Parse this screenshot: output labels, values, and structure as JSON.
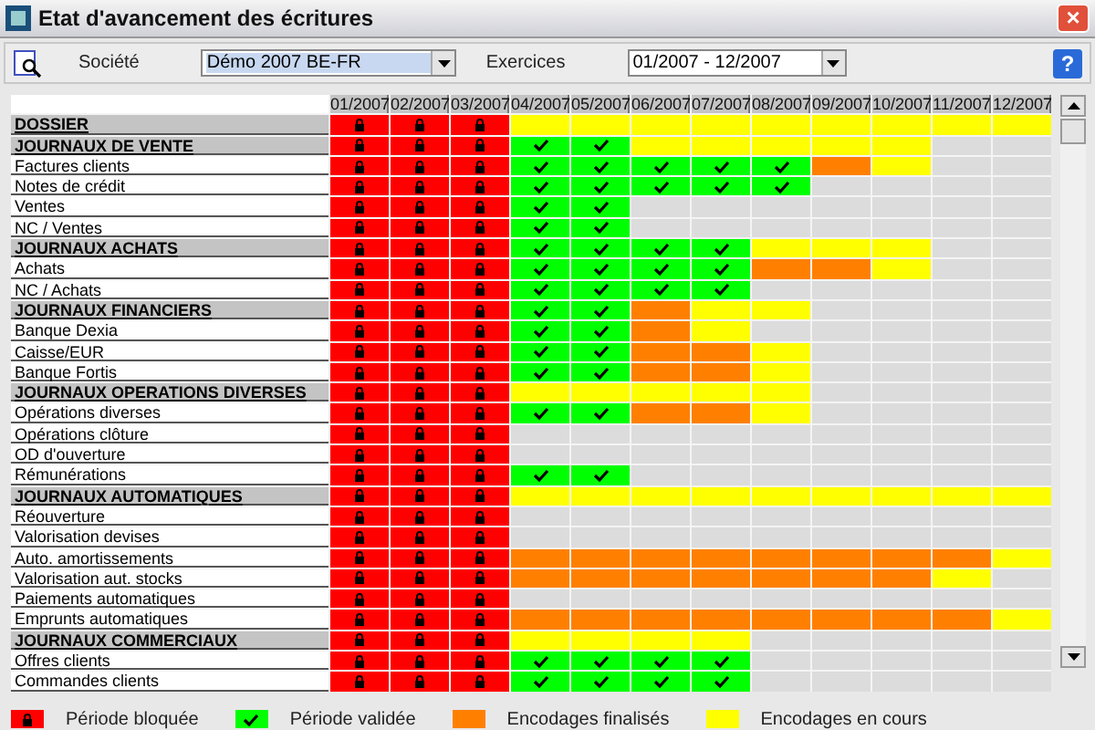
{
  "window": {
    "title": "Etat d'avancement des écritures",
    "close": "×"
  },
  "toolbar": {
    "company_label": "Société",
    "company_value": "Démo 2007 BE-FR",
    "period_label": "Exercices",
    "period_value": "01/2007 - 12/2007",
    "help": "?"
  },
  "columns": [
    "01/2007",
    "02/2007",
    "03/2007",
    "04/2007",
    "05/2007",
    "06/2007",
    "07/2007",
    "08/2007",
    "09/2007",
    "10/2007",
    "11/2007",
    "12/2007"
  ],
  "rows": [
    {
      "label": "DOSSIER",
      "kind": "group",
      "cells": [
        {
          "kind": "blocked"
        },
        {
          "kind": "blocked"
        },
        {
          "kind": "blocked"
        },
        {
          "kind": "pending"
        },
        {
          "kind": "pending"
        },
        {
          "kind": "pending"
        },
        {
          "kind": "pending"
        },
        {
          "kind": "pending"
        },
        {
          "kind": "pending"
        },
        {
          "kind": "pending"
        },
        {
          "kind": "pending"
        },
        {
          "kind": "pending"
        }
      ]
    },
    {
      "label": "JOURNAUX DE VENTE",
      "kind": "group",
      "cells": [
        {
          "kind": "blocked"
        },
        {
          "kind": "blocked"
        },
        {
          "kind": "blocked"
        },
        {
          "kind": "validated"
        },
        {
          "kind": "validated"
        },
        {
          "kind": "pending"
        },
        {
          "kind": "pending"
        },
        {
          "kind": "pending"
        },
        {
          "kind": "pending"
        },
        {
          "kind": "pending"
        },
        {
          "kind": "empty"
        },
        {
          "kind": "empty"
        }
      ]
    },
    {
      "label": "Factures clients",
      "kind": "journal",
      "cells": [
        {
          "kind": "blocked"
        },
        {
          "kind": "blocked"
        },
        {
          "kind": "blocked"
        },
        {
          "kind": "validated"
        },
        {
          "kind": "validated"
        },
        {
          "kind": "validated"
        },
        {
          "kind": "validated"
        },
        {
          "kind": "validated"
        },
        {
          "kind": "finalized"
        },
        {
          "kind": "pending"
        },
        {
          "kind": "empty"
        },
        {
          "kind": "empty"
        }
      ]
    },
    {
      "label": "Notes de crédit",
      "kind": "journal",
      "cells": [
        {
          "kind": "blocked"
        },
        {
          "kind": "blocked"
        },
        {
          "kind": "blocked"
        },
        {
          "kind": "validated"
        },
        {
          "kind": "validated"
        },
        {
          "kind": "validated"
        },
        {
          "kind": "validated"
        },
        {
          "kind": "validated"
        },
        {
          "kind": "empty"
        },
        {
          "kind": "empty"
        },
        {
          "kind": "empty"
        },
        {
          "kind": "empty"
        }
      ]
    },
    {
      "label": "Ventes",
      "kind": "journal",
      "cells": [
        {
          "kind": "blocked"
        },
        {
          "kind": "blocked"
        },
        {
          "kind": "blocked"
        },
        {
          "kind": "validated"
        },
        {
          "kind": "validated"
        },
        {
          "kind": "empty"
        },
        {
          "kind": "empty"
        },
        {
          "kind": "empty"
        },
        {
          "kind": "empty"
        },
        {
          "kind": "empty"
        },
        {
          "kind": "empty"
        },
        {
          "kind": "empty"
        }
      ]
    },
    {
      "label": "NC / Ventes",
      "kind": "journal",
      "cells": [
        {
          "kind": "blocked"
        },
        {
          "kind": "blocked"
        },
        {
          "kind": "blocked"
        },
        {
          "kind": "validated"
        },
        {
          "kind": "validated"
        },
        {
          "kind": "empty"
        },
        {
          "kind": "empty"
        },
        {
          "kind": "empty"
        },
        {
          "kind": "empty"
        },
        {
          "kind": "empty"
        },
        {
          "kind": "empty"
        },
        {
          "kind": "empty"
        }
      ]
    },
    {
      "label": "JOURNAUX ACHATS",
      "kind": "group",
      "cells": [
        {
          "kind": "blocked"
        },
        {
          "kind": "blocked"
        },
        {
          "kind": "blocked"
        },
        {
          "kind": "validated"
        },
        {
          "kind": "validated"
        },
        {
          "kind": "validated"
        },
        {
          "kind": "validated"
        },
        {
          "kind": "pending"
        },
        {
          "kind": "pending"
        },
        {
          "kind": "pending"
        },
        {
          "kind": "empty"
        },
        {
          "kind": "empty"
        }
      ]
    },
    {
      "label": "Achats",
      "kind": "journal",
      "cells": [
        {
          "kind": "blocked"
        },
        {
          "kind": "blocked"
        },
        {
          "kind": "blocked"
        },
        {
          "kind": "validated"
        },
        {
          "kind": "validated"
        },
        {
          "kind": "validated"
        },
        {
          "kind": "validated"
        },
        {
          "kind": "finalized"
        },
        {
          "kind": "finalized"
        },
        {
          "kind": "pending"
        },
        {
          "kind": "empty"
        },
        {
          "kind": "empty"
        }
      ]
    },
    {
      "label": "NC / Achats",
      "kind": "journal",
      "cells": [
        {
          "kind": "blocked"
        },
        {
          "kind": "blocked"
        },
        {
          "kind": "blocked"
        },
        {
          "kind": "validated"
        },
        {
          "kind": "validated"
        },
        {
          "kind": "validated"
        },
        {
          "kind": "validated"
        },
        {
          "kind": "empty"
        },
        {
          "kind": "empty"
        },
        {
          "kind": "empty"
        },
        {
          "kind": "empty"
        },
        {
          "kind": "empty"
        }
      ]
    },
    {
      "label": "JOURNAUX FINANCIERS",
      "kind": "group",
      "cells": [
        {
          "kind": "blocked"
        },
        {
          "kind": "blocked"
        },
        {
          "kind": "blocked"
        },
        {
          "kind": "validated"
        },
        {
          "kind": "validated"
        },
        {
          "kind": "finalized"
        },
        {
          "kind": "pending"
        },
        {
          "kind": "pending"
        },
        {
          "kind": "empty"
        },
        {
          "kind": "empty"
        },
        {
          "kind": "empty"
        },
        {
          "kind": "empty"
        }
      ]
    },
    {
      "label": "Banque Dexia",
      "kind": "journal",
      "cells": [
        {
          "kind": "blocked"
        },
        {
          "kind": "blocked"
        },
        {
          "kind": "blocked"
        },
        {
          "kind": "validated"
        },
        {
          "kind": "validated"
        },
        {
          "kind": "finalized"
        },
        {
          "kind": "pending"
        },
        {
          "kind": "empty"
        },
        {
          "kind": "empty"
        },
        {
          "kind": "empty"
        },
        {
          "kind": "empty"
        },
        {
          "kind": "empty"
        }
      ]
    },
    {
      "label": "Caisse/EUR",
      "kind": "journal",
      "cells": [
        {
          "kind": "blocked"
        },
        {
          "kind": "blocked"
        },
        {
          "kind": "blocked"
        },
        {
          "kind": "validated"
        },
        {
          "kind": "validated"
        },
        {
          "kind": "finalized"
        },
        {
          "kind": "finalized"
        },
        {
          "kind": "pending"
        },
        {
          "kind": "empty"
        },
        {
          "kind": "empty"
        },
        {
          "kind": "empty"
        },
        {
          "kind": "empty"
        }
      ]
    },
    {
      "label": "Banque Fortis",
      "kind": "journal",
      "cells": [
        {
          "kind": "blocked"
        },
        {
          "kind": "blocked"
        },
        {
          "kind": "blocked"
        },
        {
          "kind": "validated"
        },
        {
          "kind": "validated"
        },
        {
          "kind": "finalized"
        },
        {
          "kind": "finalized"
        },
        {
          "kind": "pending"
        },
        {
          "kind": "empty"
        },
        {
          "kind": "empty"
        },
        {
          "kind": "empty"
        },
        {
          "kind": "empty"
        }
      ]
    },
    {
      "label": "JOURNAUX OPERATIONS DIVERSES",
      "kind": "group",
      "cells": [
        {
          "kind": "blocked"
        },
        {
          "kind": "blocked"
        },
        {
          "kind": "blocked"
        },
        {
          "kind": "pending"
        },
        {
          "kind": "pending"
        },
        {
          "kind": "pending"
        },
        {
          "kind": "pending"
        },
        {
          "kind": "pending"
        },
        {
          "kind": "empty"
        },
        {
          "kind": "empty"
        },
        {
          "kind": "empty"
        },
        {
          "kind": "empty"
        }
      ]
    },
    {
      "label": "Opérations diverses",
      "kind": "journal",
      "cells": [
        {
          "kind": "blocked"
        },
        {
          "kind": "blocked"
        },
        {
          "kind": "blocked"
        },
        {
          "kind": "validated"
        },
        {
          "kind": "validated"
        },
        {
          "kind": "finalized"
        },
        {
          "kind": "finalized"
        },
        {
          "kind": "pending"
        },
        {
          "kind": "empty"
        },
        {
          "kind": "empty"
        },
        {
          "kind": "empty"
        },
        {
          "kind": "empty"
        }
      ]
    },
    {
      "label": "Opérations clôture",
      "kind": "journal",
      "cells": [
        {
          "kind": "blocked"
        },
        {
          "kind": "blocked"
        },
        {
          "kind": "blocked"
        },
        {
          "kind": "empty"
        },
        {
          "kind": "empty"
        },
        {
          "kind": "empty"
        },
        {
          "kind": "empty"
        },
        {
          "kind": "empty"
        },
        {
          "kind": "empty"
        },
        {
          "kind": "empty"
        },
        {
          "kind": "empty"
        },
        {
          "kind": "empty"
        }
      ]
    },
    {
      "label": "OD d'ouverture",
      "kind": "journal",
      "cells": [
        {
          "kind": "blocked"
        },
        {
          "kind": "blocked"
        },
        {
          "kind": "blocked"
        },
        {
          "kind": "empty"
        },
        {
          "kind": "empty"
        },
        {
          "kind": "empty"
        },
        {
          "kind": "empty"
        },
        {
          "kind": "empty"
        },
        {
          "kind": "empty"
        },
        {
          "kind": "empty"
        },
        {
          "kind": "empty"
        },
        {
          "kind": "empty"
        }
      ]
    },
    {
      "label": "Rémunérations",
      "kind": "journal",
      "cells": [
        {
          "kind": "blocked"
        },
        {
          "kind": "blocked"
        },
        {
          "kind": "blocked"
        },
        {
          "kind": "validated"
        },
        {
          "kind": "validated"
        },
        {
          "kind": "empty"
        },
        {
          "kind": "empty"
        },
        {
          "kind": "empty"
        },
        {
          "kind": "empty"
        },
        {
          "kind": "empty"
        },
        {
          "kind": "empty"
        },
        {
          "kind": "empty"
        }
      ]
    },
    {
      "label": "JOURNAUX AUTOMATIQUES",
      "kind": "group",
      "cells": [
        {
          "kind": "blocked"
        },
        {
          "kind": "blocked"
        },
        {
          "kind": "blocked"
        },
        {
          "kind": "pending"
        },
        {
          "kind": "pending"
        },
        {
          "kind": "pending"
        },
        {
          "kind": "pending"
        },
        {
          "kind": "pending"
        },
        {
          "kind": "pending"
        },
        {
          "kind": "pending"
        },
        {
          "kind": "pending"
        },
        {
          "kind": "pending"
        }
      ]
    },
    {
      "label": "Réouverture",
      "kind": "journal",
      "cells": [
        {
          "kind": "blocked"
        },
        {
          "kind": "blocked"
        },
        {
          "kind": "blocked"
        },
        {
          "kind": "empty"
        },
        {
          "kind": "empty"
        },
        {
          "kind": "empty"
        },
        {
          "kind": "empty"
        },
        {
          "kind": "empty"
        },
        {
          "kind": "empty"
        },
        {
          "kind": "empty"
        },
        {
          "kind": "empty"
        },
        {
          "kind": "empty"
        }
      ]
    },
    {
      "label": "Valorisation devises",
      "kind": "journal",
      "cells": [
        {
          "kind": "blocked"
        },
        {
          "kind": "blocked"
        },
        {
          "kind": "blocked"
        },
        {
          "kind": "empty"
        },
        {
          "kind": "empty"
        },
        {
          "kind": "empty"
        },
        {
          "kind": "empty"
        },
        {
          "kind": "empty"
        },
        {
          "kind": "empty"
        },
        {
          "kind": "empty"
        },
        {
          "kind": "empty"
        },
        {
          "kind": "empty"
        }
      ]
    },
    {
      "label": "Auto. amortissements",
      "kind": "journal",
      "cells": [
        {
          "kind": "blocked"
        },
        {
          "kind": "blocked"
        },
        {
          "kind": "blocked"
        },
        {
          "kind": "finalized"
        },
        {
          "kind": "finalized"
        },
        {
          "kind": "finalized"
        },
        {
          "kind": "finalized"
        },
        {
          "kind": "finalized"
        },
        {
          "kind": "finalized"
        },
        {
          "kind": "finalized"
        },
        {
          "kind": "finalized"
        },
        {
          "kind": "pending"
        }
      ]
    },
    {
      "label": "Valorisation aut. stocks",
      "kind": "journal",
      "cells": [
        {
          "kind": "blocked"
        },
        {
          "kind": "blocked"
        },
        {
          "kind": "blocked"
        },
        {
          "kind": "finalized"
        },
        {
          "kind": "finalized"
        },
        {
          "kind": "finalized"
        },
        {
          "kind": "finalized"
        },
        {
          "kind": "finalized"
        },
        {
          "kind": "finalized"
        },
        {
          "kind": "finalized"
        },
        {
          "kind": "pending"
        },
        {
          "kind": "empty"
        }
      ]
    },
    {
      "label": "Paiements automatiques",
      "kind": "journal",
      "cells": [
        {
          "kind": "blocked"
        },
        {
          "kind": "blocked"
        },
        {
          "kind": "blocked"
        },
        {
          "kind": "empty"
        },
        {
          "kind": "empty"
        },
        {
          "kind": "empty"
        },
        {
          "kind": "empty"
        },
        {
          "kind": "empty"
        },
        {
          "kind": "empty"
        },
        {
          "kind": "empty"
        },
        {
          "kind": "empty"
        },
        {
          "kind": "empty"
        }
      ]
    },
    {
      "label": "Emprunts automatiques",
      "kind": "journal",
      "cells": [
        {
          "kind": "blocked"
        },
        {
          "kind": "blocked"
        },
        {
          "kind": "blocked"
        },
        {
          "kind": "finalized"
        },
        {
          "kind": "finalized"
        },
        {
          "kind": "finalized"
        },
        {
          "kind": "finalized"
        },
        {
          "kind": "finalized"
        },
        {
          "kind": "finalized"
        },
        {
          "kind": "finalized"
        },
        {
          "kind": "finalized"
        },
        {
          "kind": "pending"
        }
      ]
    },
    {
      "label": "JOURNAUX COMMERCIAUX",
      "kind": "group",
      "cells": [
        {
          "kind": "blocked"
        },
        {
          "kind": "blocked"
        },
        {
          "kind": "blocked"
        },
        {
          "kind": "pending"
        },
        {
          "kind": "pending"
        },
        {
          "kind": "pending"
        },
        {
          "kind": "pending"
        },
        {
          "kind": "empty"
        },
        {
          "kind": "empty"
        },
        {
          "kind": "empty"
        },
        {
          "kind": "empty"
        },
        {
          "kind": "empty"
        }
      ]
    },
    {
      "label": "Offres clients",
      "kind": "journal",
      "cells": [
        {
          "kind": "blocked"
        },
        {
          "kind": "blocked"
        },
        {
          "kind": "blocked"
        },
        {
          "kind": "validated"
        },
        {
          "kind": "validated"
        },
        {
          "kind": "validated"
        },
        {
          "kind": "validated"
        },
        {
          "kind": "empty"
        },
        {
          "kind": "empty"
        },
        {
          "kind": "empty"
        },
        {
          "kind": "empty"
        },
        {
          "kind": "empty"
        }
      ]
    },
    {
      "label": "Commandes clients",
      "kind": "journal",
      "cells": [
        {
          "kind": "blocked"
        },
        {
          "kind": "blocked"
        },
        {
          "kind": "blocked"
        },
        {
          "kind": "validated"
        },
        {
          "kind": "validated"
        },
        {
          "kind": "validated"
        },
        {
          "kind": "validated"
        },
        {
          "kind": "empty"
        },
        {
          "kind": "empty"
        },
        {
          "kind": "empty"
        },
        {
          "kind": "empty"
        },
        {
          "kind": "empty"
        }
      ]
    }
  ],
  "legend": [
    {
      "kind": "blocked",
      "label": "Période bloquée"
    },
    {
      "kind": "validated",
      "label": "Période validée"
    },
    {
      "kind": "finalized",
      "label": "Encodages finalisés"
    },
    {
      "kind": "pending",
      "label": "Encodages en cours"
    }
  ]
}
